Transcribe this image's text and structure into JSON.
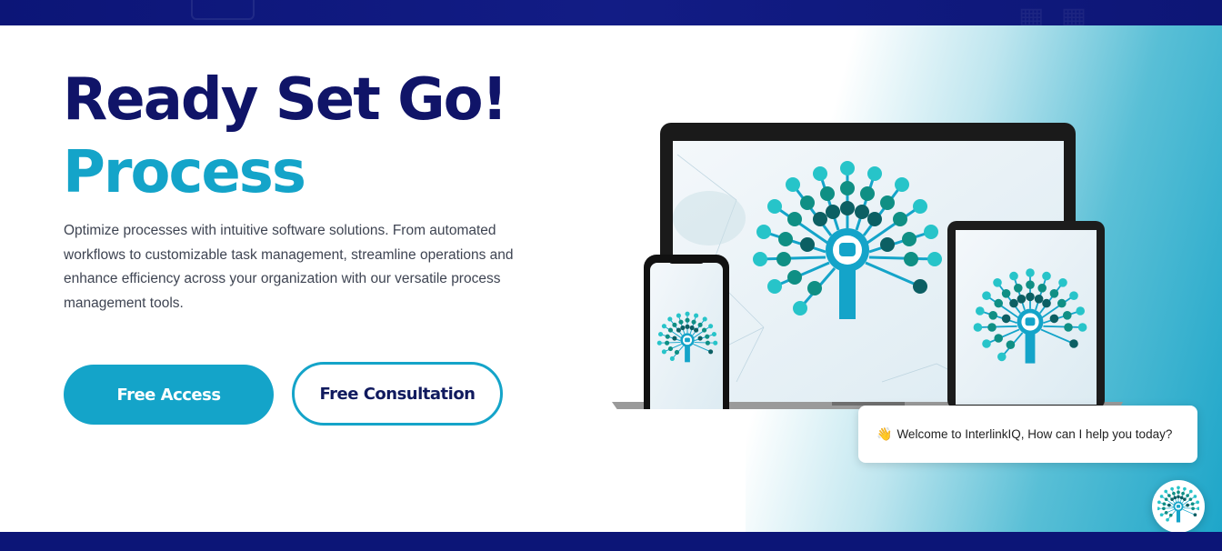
{
  "hero": {
    "title_line1": "Ready Set Go!",
    "title_line2": "Process",
    "description": "Optimize processes with intuitive software solutions. From automated workflows to customizable task management, streamline operations and enhance efficiency across your organization with our versatile process management tools.",
    "primary_button": "Free Access",
    "secondary_button": "Free Consultation"
  },
  "chat": {
    "wave_emoji": "👋",
    "welcome_message": "Welcome to InterlinkIQ, How can I help you today?",
    "launcher_icon": "interlinkiq-tree-icon"
  },
  "colors": {
    "navy": "#101468",
    "accent": "#14a4c9",
    "band": "#0c1577"
  }
}
